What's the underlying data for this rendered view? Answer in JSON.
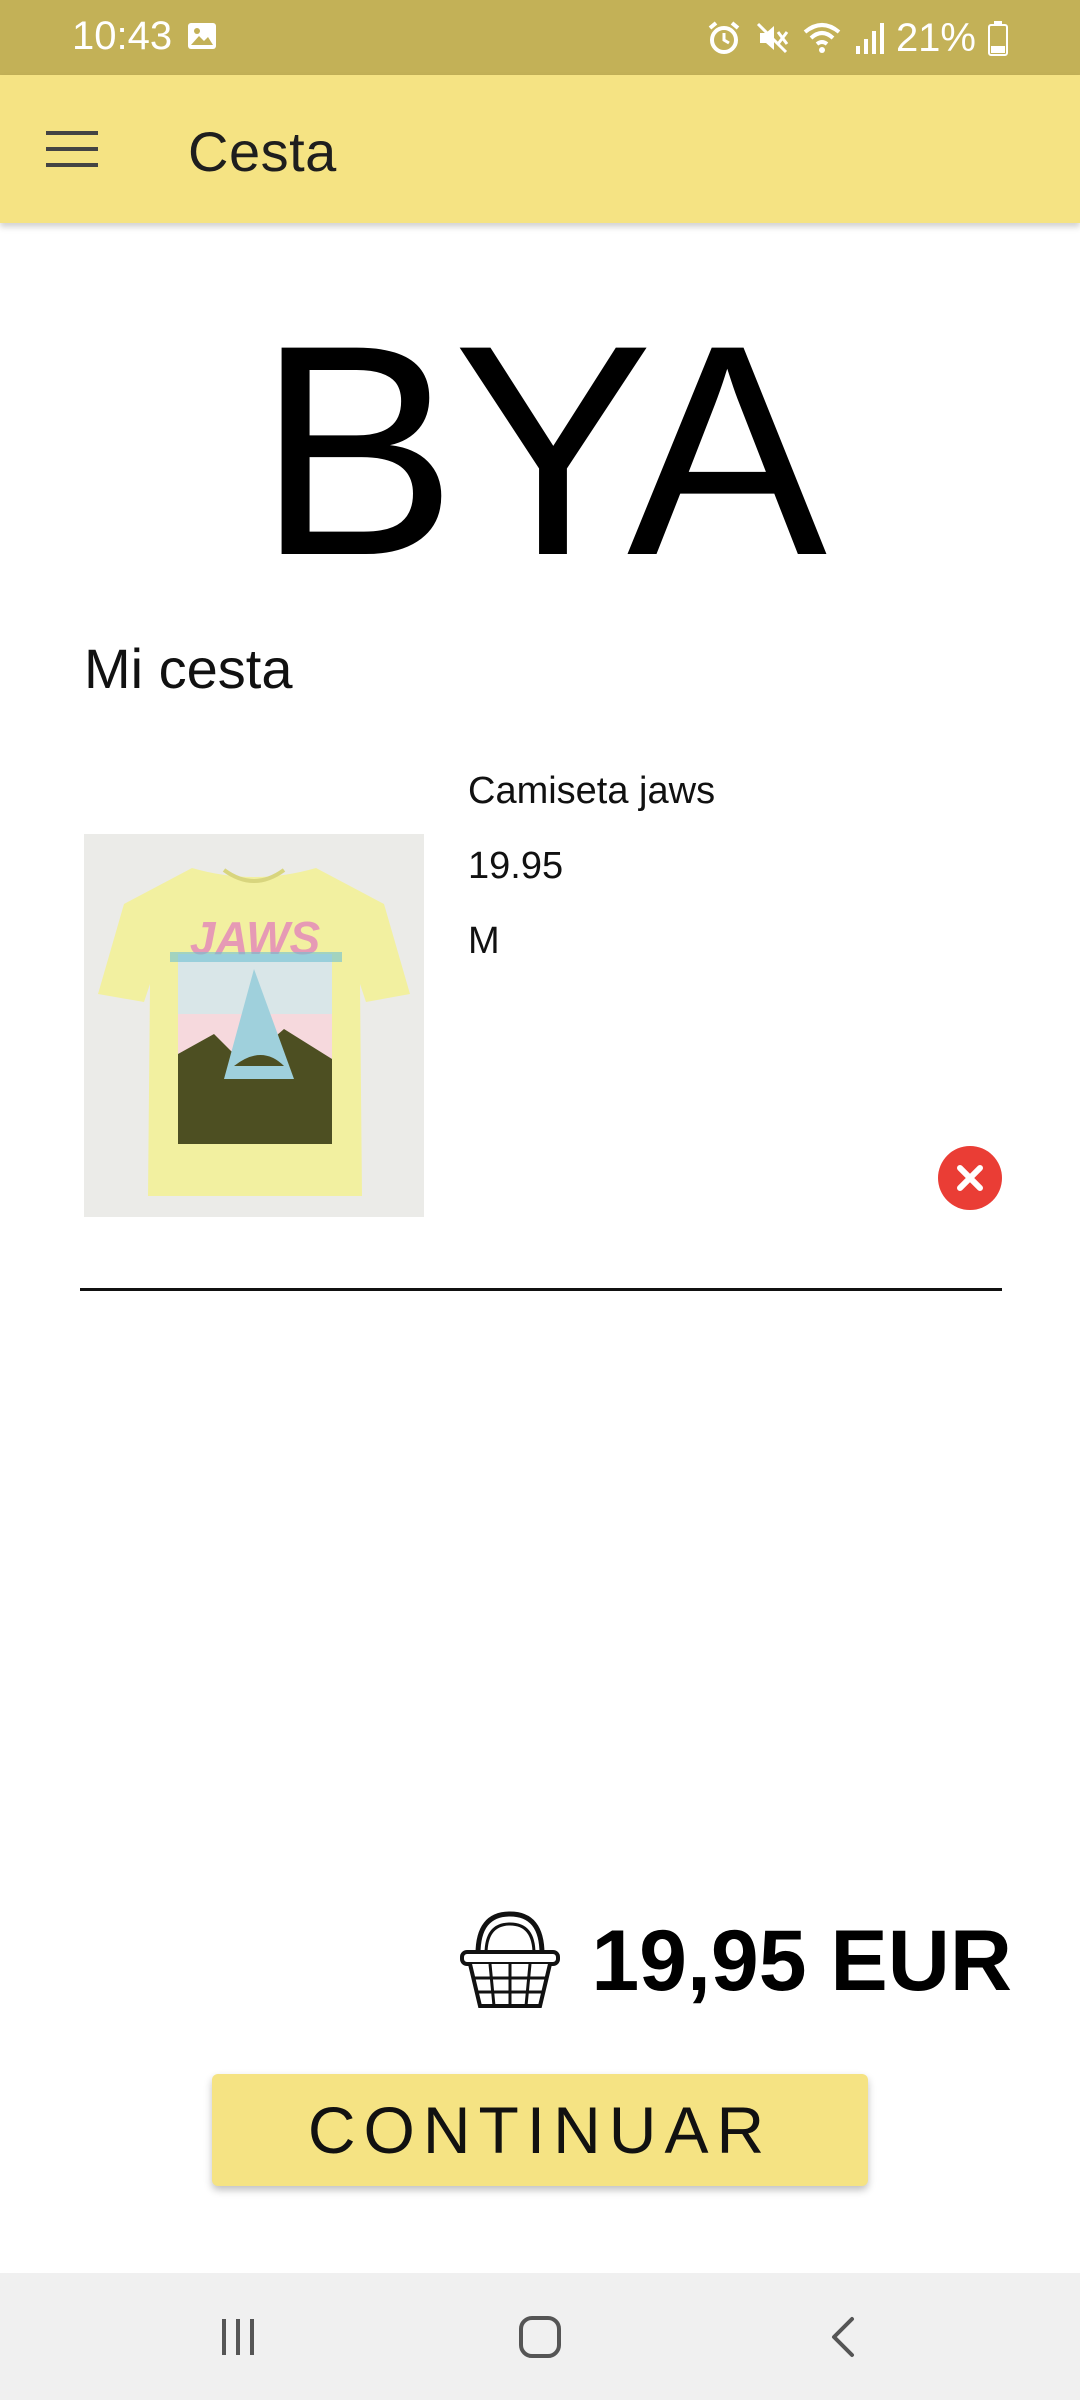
{
  "status_bar": {
    "time": "10:43",
    "battery": "21%",
    "icons": [
      "image-icon",
      "alarm-icon",
      "mute-icon",
      "wifi-icon",
      "signal-icon",
      "battery-icon"
    ]
  },
  "app_bar": {
    "title": "Cesta",
    "menu_icon": "hamburger-menu-icon"
  },
  "logo": "BYA",
  "section_title": "Mi cesta",
  "cart_items": [
    {
      "name": "Camiseta jaws",
      "price": "19.95",
      "size": "M",
      "image_alt": "Camiseta amarilla con estampado JAWS",
      "image_text": "JAWS"
    }
  ],
  "total": "19,95 EUR",
  "continue_label": "CONTINUAR",
  "colors": {
    "status_bar": "#c3b157",
    "app_bar": "#f5e383",
    "button": "#f5e383",
    "remove": "#ea3d35",
    "nav_bar": "#f0f0f0"
  },
  "nav_bar": {
    "icons": [
      "recents-icon",
      "home-icon",
      "back-icon"
    ]
  }
}
